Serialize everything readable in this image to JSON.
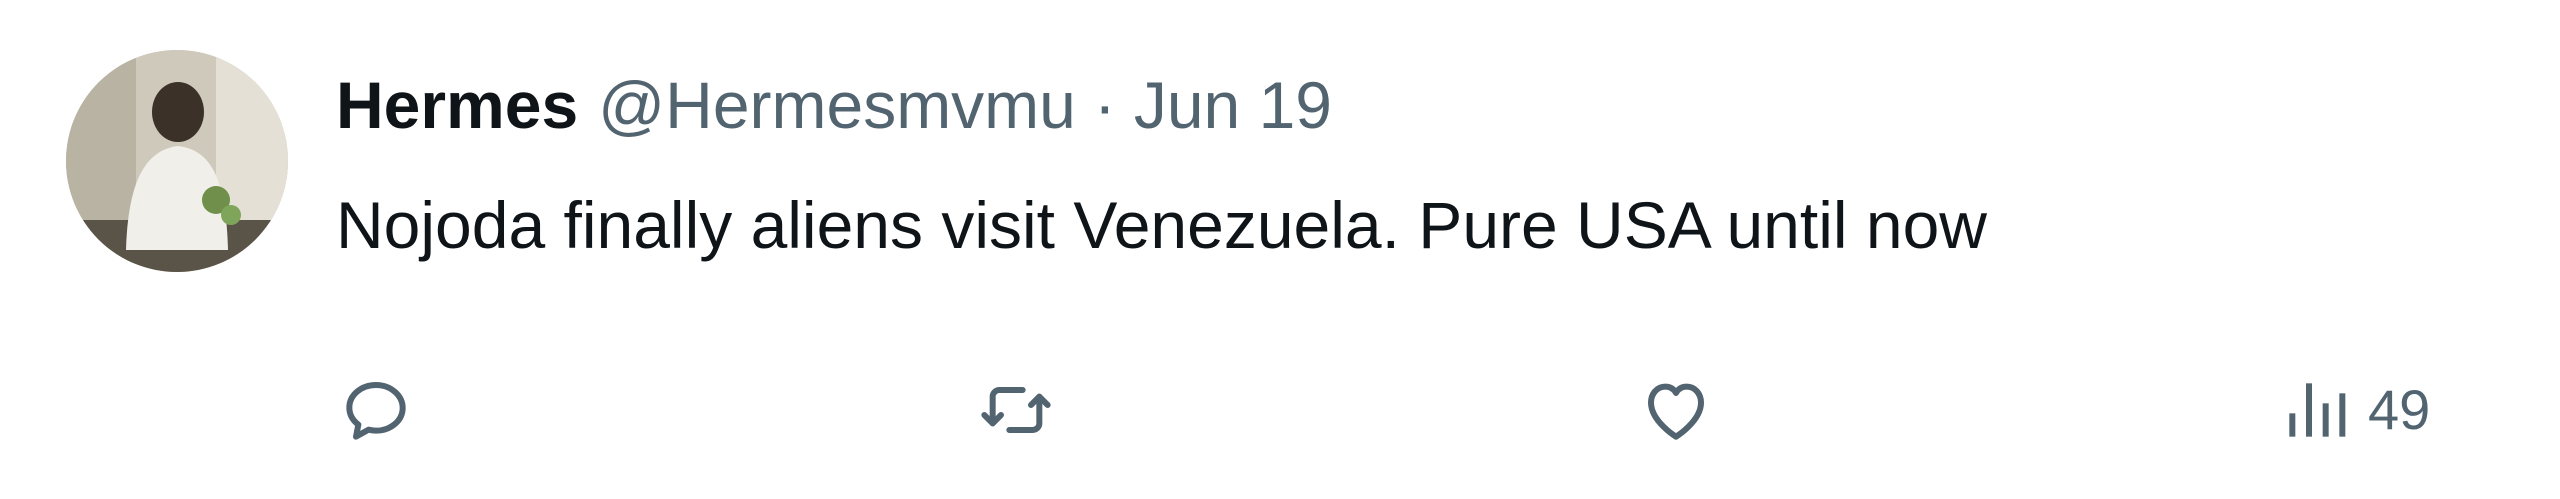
{
  "tweet": {
    "author": {
      "display_name": "Hermes",
      "handle": "@Hermesmvmu"
    },
    "separator": "·",
    "date": "Jun 19",
    "text": "Nojoda finally aliens visit Venezuela. Pure USA until now",
    "actions": {
      "reply_icon": "reply-icon",
      "repost_icon": "repost-icon",
      "like_icon": "like-heart-icon",
      "views_icon": "views-bar-chart-icon",
      "views_count": "49"
    }
  },
  "colors": {
    "text_primary": "#0f1419",
    "text_secondary": "#536471",
    "background": "#ffffff"
  }
}
